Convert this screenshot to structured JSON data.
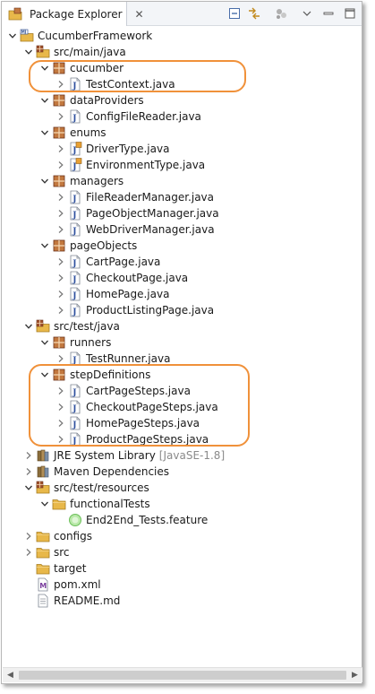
{
  "view": {
    "tab_title": "Package Explorer",
    "toolbar_icons": [
      "collapse-all-icon",
      "link-with-editor-icon",
      "focus-on-active-task-icon",
      "view-menu-icon",
      "minimize-icon",
      "maximize-icon"
    ]
  },
  "tree": {
    "project": "CucumberFramework",
    "src_main": "src/main/java",
    "pkg_cucumber": "cucumber",
    "file_testcontext": "TestContext.java",
    "pkg_dataproviders": "dataProviders",
    "file_configfilereader": "ConfigFileReader.java",
    "pkg_enums": "enums",
    "file_drivertype": "DriverType.java",
    "file_environmenttype": "EnvironmentType.java",
    "pkg_managers": "managers",
    "file_filereadermanager": "FileReaderManager.java",
    "file_pageobjectmanager": "PageObjectManager.java",
    "file_webdrivermanager": "WebDriverManager.java",
    "pkg_pageobjects": "pageObjects",
    "file_cartpage": "CartPage.java",
    "file_checkoutpage": "CheckoutPage.java",
    "file_homepage": "HomePage.java",
    "file_productlistingpage": "ProductListingPage.java",
    "src_test": "src/test/java",
    "pkg_runners": "runners",
    "file_testrunner": "TestRunner.java",
    "pkg_stepdefinitions": "stepDefinitions",
    "file_cartpagesteps": "CartPageSteps.java",
    "file_checkoutpagesteps": "CheckoutPageSteps.java",
    "file_homepagesteps": "HomePageSteps.java",
    "file_productpagesteps": "ProductPageSteps.java",
    "jre_library": "JRE System Library",
    "jre_version": "[JavaSE-1.8]",
    "maven_deps": "Maven Dependencies",
    "src_test_resources": "src/test/resources",
    "folder_functionaltests": "functionalTests",
    "file_feature": "End2End_Tests.feature",
    "folder_configs": "configs",
    "folder_src": "src",
    "folder_target": "target",
    "file_pom": "pom.xml",
    "file_readme": "README.md"
  },
  "colors": {
    "highlight": "#f0913a",
    "package_icon": "#a0522d",
    "folder_icon": "#e8b84a",
    "java_icon": "#2d4f9e"
  }
}
